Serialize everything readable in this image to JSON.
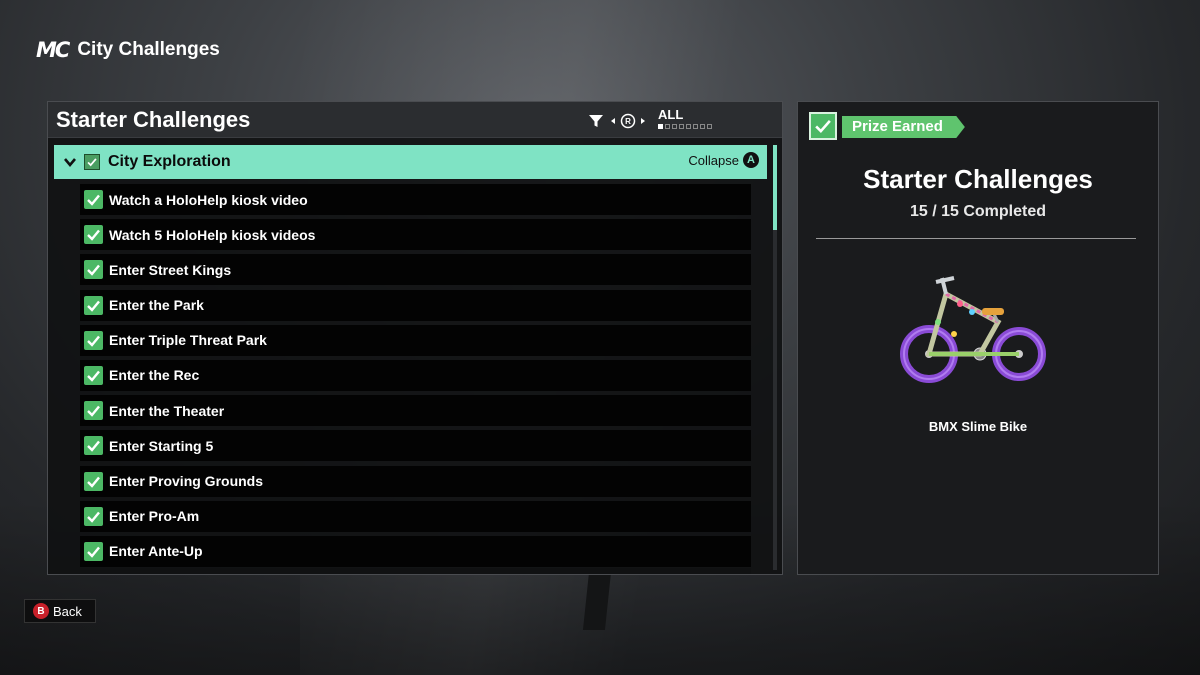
{
  "header": {
    "logo": "MC",
    "title": "City Challenges"
  },
  "left_panel": {
    "title": "Starter Challenges",
    "filter": {
      "stick_button": "R",
      "value": "ALL",
      "pages": 8,
      "current_page": 1
    },
    "category": {
      "label": "City Exploration",
      "completed": true,
      "collapse_label": "Collapse",
      "collapse_button": "A"
    },
    "items": [
      {
        "label": "Watch a HoloHelp kiosk video",
        "completed": true
      },
      {
        "label": "Watch 5 HoloHelp kiosk videos",
        "completed": true
      },
      {
        "label": "Enter Street Kings",
        "completed": true
      },
      {
        "label": "Enter the Park",
        "completed": true
      },
      {
        "label": "Enter Triple Threat Park",
        "completed": true
      },
      {
        "label": "Enter the Rec",
        "completed": true
      },
      {
        "label": "Enter the Theater",
        "completed": true
      },
      {
        "label": "Enter Starting 5",
        "completed": true
      },
      {
        "label": "Enter Proving Grounds",
        "completed": true
      },
      {
        "label": "Enter Pro-Am",
        "completed": true
      },
      {
        "label": "Enter Ante-Up",
        "completed": true
      }
    ]
  },
  "right_panel": {
    "badge": "Prize Earned",
    "title": "Starter Challenges",
    "progress": "15 / 15 Completed",
    "prize_name": "BMX Slime Bike",
    "prize_icon": "bmx-bike-icon"
  },
  "footer": {
    "back_button": "B",
    "back_label": "Back"
  },
  "colors": {
    "accent": "#7fe3c4",
    "check_green": "#4cb865",
    "badge_green": "#5fc46e",
    "b_button": "#c8202a"
  }
}
